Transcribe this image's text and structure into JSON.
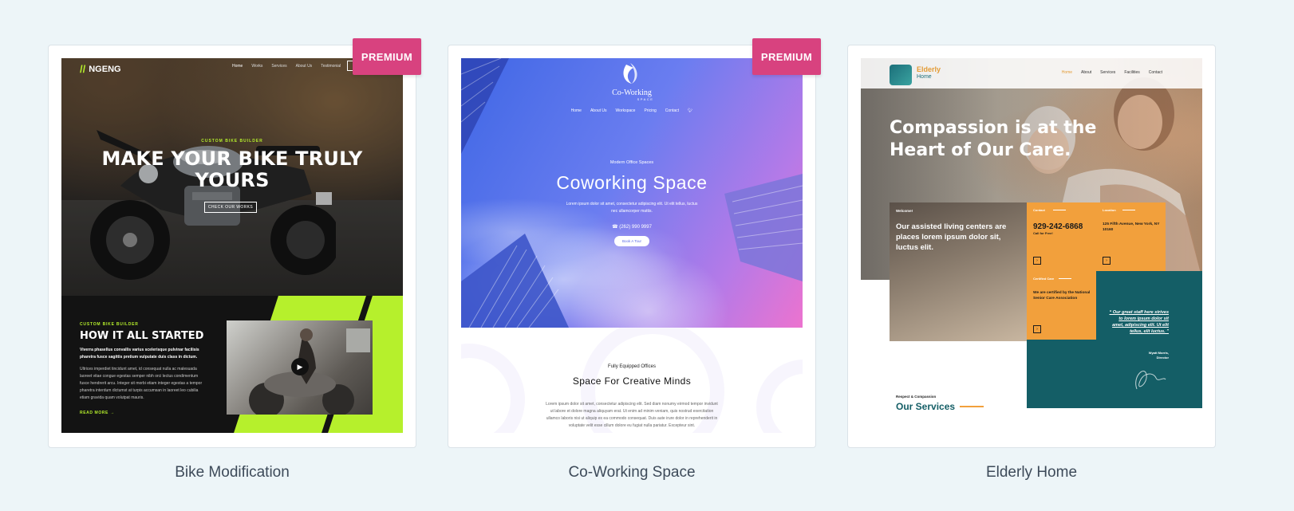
{
  "cards": [
    {
      "title": "Bike Modification",
      "badge": "PREMIUM",
      "preview": {
        "brand": "NGENG",
        "nav": [
          "Home",
          "Works",
          "Services",
          "About Us",
          "Testimonial"
        ],
        "kicker": "CUSTOM BIKE BUILDER",
        "headline": "MAKE YOUR BIKE TRULY YOURS",
        "button": "CHECK OUR WORKS",
        "section_kicker": "CUSTOM BIKE BUILDER",
        "section_title": "HOW IT ALL STARTED",
        "section_lead": "Viverra phasellus convallis varius scelerisque pulvinar facilisis pharetra fusce sagittis pretium vulputate duis class in dictum.",
        "section_body": "Ultrices imperdiet tincidunt amet, id consequat nulla ac malesuada laoreet vitae congue egestas semper nibh orci lectus condimentum fusce hendrerit arcu. Integer sit morbi etiam integer egestas a tempor pharetra interdum dictumst at turpis accumsan in laoreet leo cubilia etiam gravida quam volutpat mauris.",
        "read_more": "READ MORE →",
        "accent": "#b6f02c"
      }
    },
    {
      "title": "Co-Working Space",
      "badge": "PREMIUM",
      "preview": {
        "logo_text": "Co-Working",
        "logo_sub": "SPACE",
        "nav": [
          "Home",
          "About Us",
          "Workspace",
          "Pricing",
          "Contact"
        ],
        "kicker": "Modern Office Spaces",
        "headline": "Coworking Space",
        "description": "Lorem ipsum dolor sit amet, consectetur adipiscing elit. Ut elit tellus, luctus nec ullamcorper mattis.",
        "phone": "☎ (262) 990 9997",
        "button": "Book A Tour",
        "section_kicker": "Fully Equipped Offices",
        "section_title": "Space For Creative Minds",
        "section_body": "Lorem ipsum dolor sit amet, consectetur adipiscing elit. Sed diam nonumy eirmod tempor invidunt ut labore et dolore magna aliquyam erat. Ut enim ad minim veniam, quis nostrud exercitation ullamco laboris nisi ut aliquip ex ea commodo consequat. Duis aute irure dolor in reprehenderit in voluptate velit esse cillum dolore eu fugiat nulla pariatur. Excepteur sint."
      }
    },
    {
      "title": "Elderly Home",
      "badge": "",
      "preview": {
        "logo_line1": "Elderly",
        "logo_line2": "Home",
        "nav": [
          "Home",
          "About",
          "Services",
          "Facilities",
          "Contact"
        ],
        "headline": "Compassion is at the Heart of Our Care.",
        "welcome_label": "Welcome!",
        "welcome_text": "Our assisted living centers are places lorem ipsum dolor sit, luctus elit.",
        "contact_label": "Contact",
        "contact_value": "929-242-6868",
        "contact_small": "Call for Free!",
        "location_label": "Location",
        "location_value": "125 Fifth Avenue, New York, NY 10160",
        "certified_label": "Certified Care",
        "certified_text": "We are certified by the National Senior Care Association",
        "quote": "“ Our great staff here strives to lorem ipsum dolor sit amet, adipiscing elit. Ut elit tellus, elit luctus. ”",
        "quote_author": "Wyatt Morris,",
        "quote_role": "Director",
        "services_kicker": "Respect & Compassion",
        "services_title": "Our Services",
        "accent": "#f2a03c",
        "teal": "#145e66"
      }
    }
  ]
}
